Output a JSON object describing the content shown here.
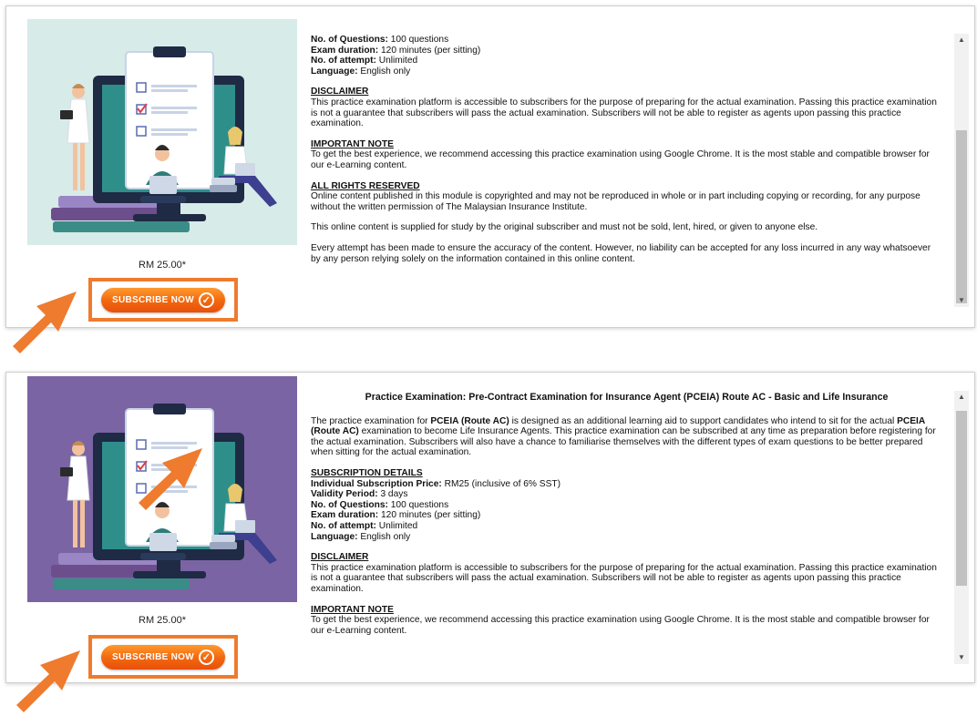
{
  "colors": {
    "accent_orange": "#ee7b2e",
    "illus_bg_1": "#d7ebe9",
    "illus_bg_2": "#7a64a4"
  },
  "card1": {
    "price": "RM 25.00*",
    "subscribe_label": "SUBSCRIBE NOW",
    "lines": [
      {
        "label": "No. of Questions:",
        "value": " 100 questions"
      },
      {
        "label": "Exam duration:",
        "value": " 120 minutes (per sitting)"
      },
      {
        "label": "No. of attempt:",
        "value": " Unlimited"
      },
      {
        "label": "Language:",
        "value": " English only"
      }
    ],
    "disclaimer_head": "DISCLAIMER",
    "disclaimer": "This practice examination platform is accessible to subscribers for the purpose of preparing for the actual examination. Passing this practice examination is not a guarantee that subscribers will pass the actual examination. Subscribers will not be able to register as agents upon passing this practice examination.",
    "note_head": "IMPORTANT NOTE",
    "note": "To get the best experience, we recommend accessing this practice examination using Google Chrome. It is the most stable and compatible browser for our e-Learning content.",
    "rights_head": "ALL RIGHTS RESERVED",
    "rights_1": "Online content published in this module is copyrighted and may not be reproduced in whole or in part including copying or recording, for any purpose without the written permission of The Malaysian Insurance Institute.",
    "rights_2": "This online content is supplied for study by the original subscriber and must not be sold, lent, hired, or given to anyone else.",
    "rights_3": "Every attempt has been made to ensure the accuracy of the content. However, no liability can be accepted for any loss incurred in any way whatsoever by any person relying solely on the information contained in this online content."
  },
  "card2": {
    "price": "RM 25.00*",
    "subscribe_label": "SUBSCRIBE NOW",
    "title": "Practice Examination: Pre-Contract Examination for Insurance Agent (PCEIA) Route AC - Basic and Life Insurance",
    "intro": {
      "p1": "The practice examination for ",
      "b1": "PCEIA (Route AC)",
      "p2": " is designed as an additional learning aid to support candidates who intend to sit for the actual ",
      "b2": "PCEIA (Route AC)",
      "p3": " examination to become Life Insurance Agents. This practice examination can be subscribed at any time as preparation before registering for the actual examination. Subscribers will also have a chance to familiarise themselves with the different types of exam questions to be better prepared when sitting for the actual examination."
    },
    "sub_head": "SUBSCRIPTION DETAILS",
    "lines": [
      {
        "label": "Individual Subscription Price:",
        "value": " RM25 (inclusive of 6% SST)"
      },
      {
        "label": "Validity Period:",
        "value": " 3 days"
      },
      {
        "label": "No. of Questions:",
        "value": " 100 questions"
      },
      {
        "label": "Exam duration:",
        "value": " 120 minutes (per sitting)"
      },
      {
        "label": "No. of attempt:",
        "value": " Unlimited"
      },
      {
        "label": "Language:",
        "value": " English only"
      }
    ],
    "disclaimer_head": "DISCLAIMER",
    "disclaimer": "This practice examination platform is accessible to subscribers for the purpose of preparing for the actual examination. Passing this practice examination is not a guarantee that subscribers will pass the actual examination. Subscribers will not be able to register as agents upon passing this practice examination.",
    "note_head": "IMPORTANT NOTE",
    "note": "To get the best experience, we recommend accessing this practice examination using Google Chrome. It is the most stable and compatible browser for our e-Learning content."
  }
}
